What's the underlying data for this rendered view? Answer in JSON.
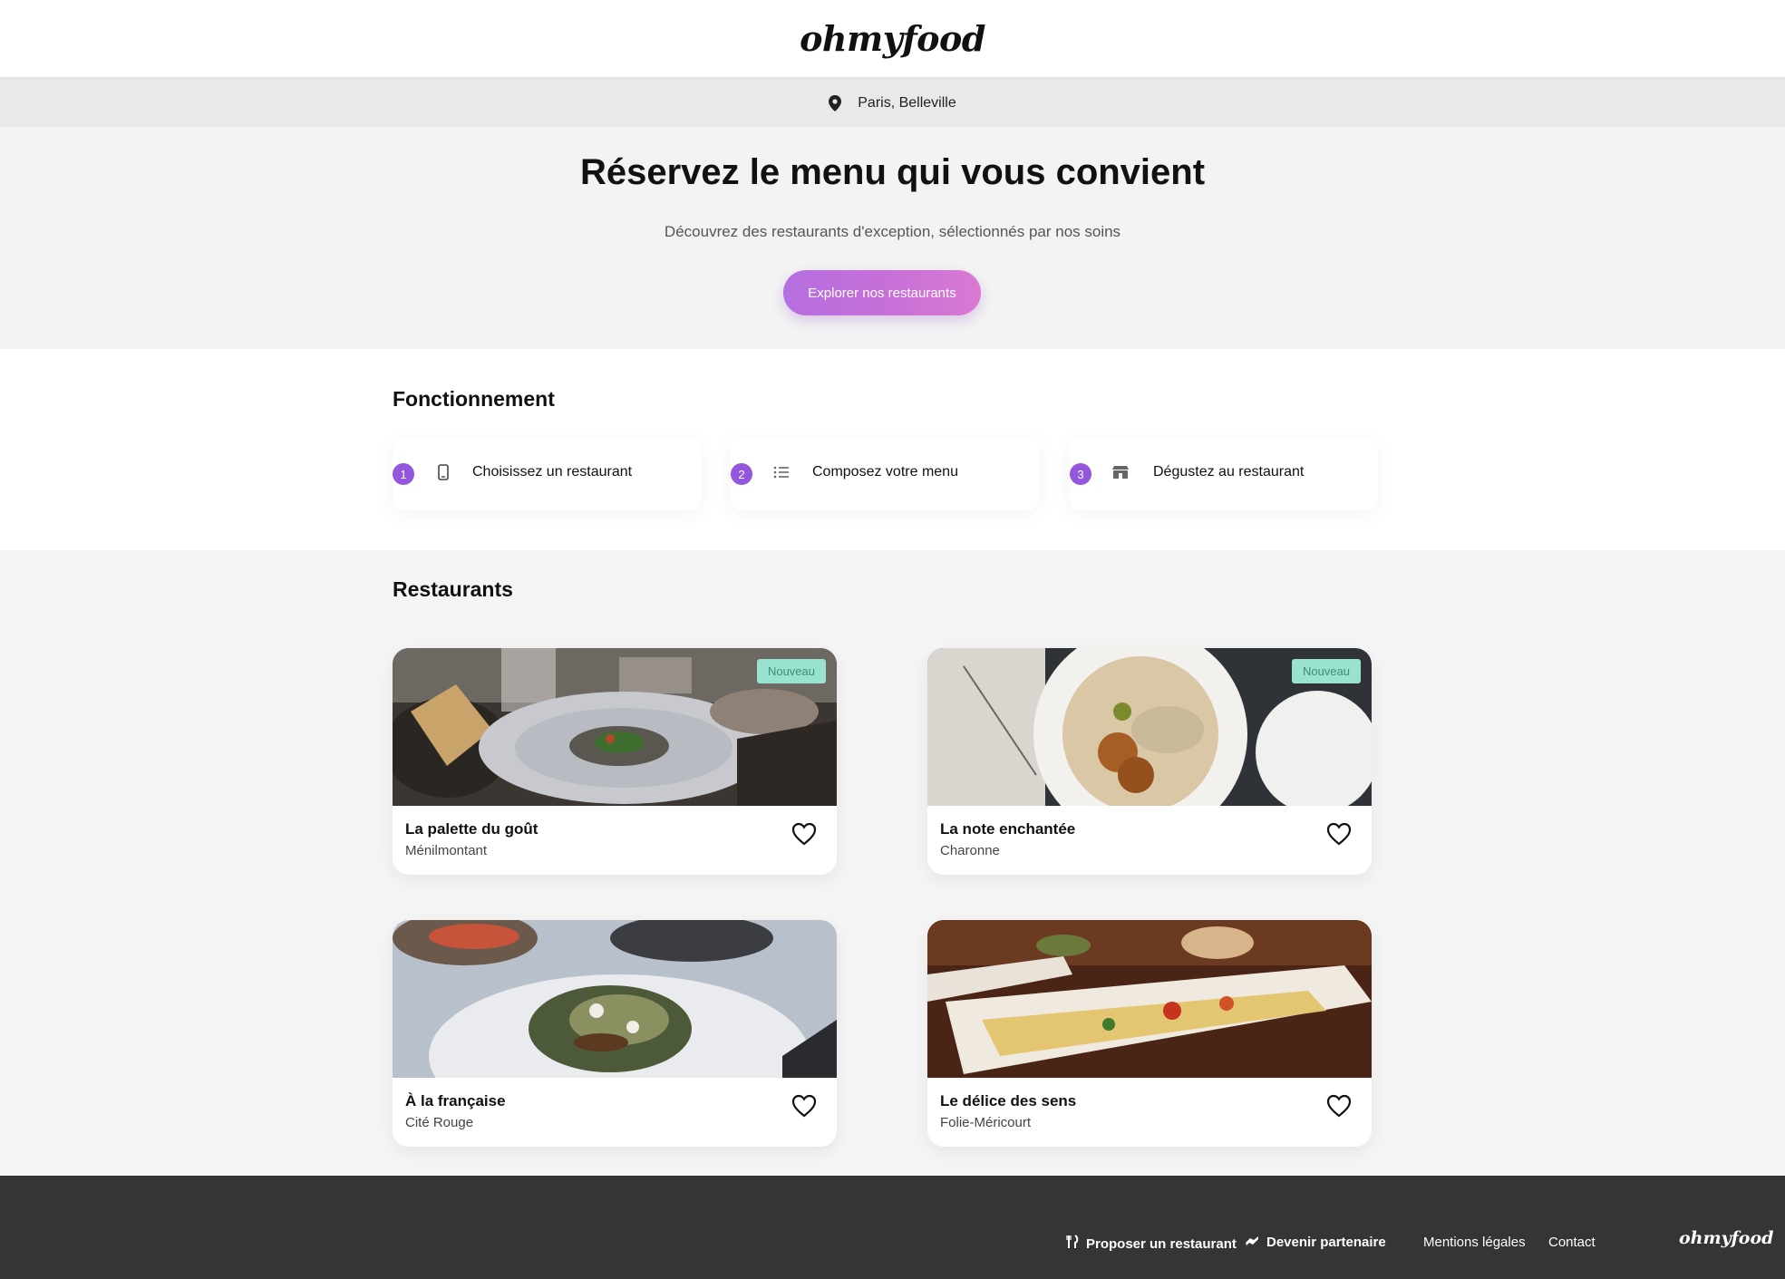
{
  "brand": {
    "logo": "ohmyfood"
  },
  "location": {
    "label": "Paris, Belleville",
    "icon": "map-pin-icon"
  },
  "hero": {
    "title": "Réservez le menu qui vous convient",
    "subtitle": "Découvrez des restaurants d'exception, sélectionnés par nos soins",
    "cta_label": "Explorer nos restaurants"
  },
  "how": {
    "title": "Fonctionnement",
    "steps": [
      {
        "number": "1",
        "icon": "phone-icon",
        "label": "Choisissez un restaurant"
      },
      {
        "number": "2",
        "icon": "list-icon",
        "label": "Composez votre menu"
      },
      {
        "number": "3",
        "icon": "store-icon",
        "label": "Dégustez au restaurant"
      }
    ]
  },
  "restaurants": {
    "title": "Restaurants",
    "items": [
      {
        "name": "La palette du goût",
        "area": "Ménilmontant",
        "badge": "Nouveau"
      },
      {
        "name": "La note enchantée",
        "area": "Charonne",
        "badge": "Nouveau"
      },
      {
        "name": "À la française",
        "area": "Cité Rouge",
        "badge": ""
      },
      {
        "name": "Le délice des sens",
        "area": "Folie-Méricourt",
        "badge": ""
      }
    ]
  },
  "footer": {
    "links": [
      {
        "label": "Proposer un restaurant",
        "icon": "utensils-icon"
      },
      {
        "label": "Devenir partenaire",
        "icon": "handshake-icon"
      },
      {
        "label": "Mentions légales"
      },
      {
        "label": "Contact"
      }
    ],
    "logo": "ohmyfood"
  },
  "colors": {
    "accent": "#9356dc",
    "cta_start": "#b56fe0",
    "cta_end": "#d97ad2",
    "badge_bg": "#99e2d0",
    "footer_bg": "#353535"
  }
}
